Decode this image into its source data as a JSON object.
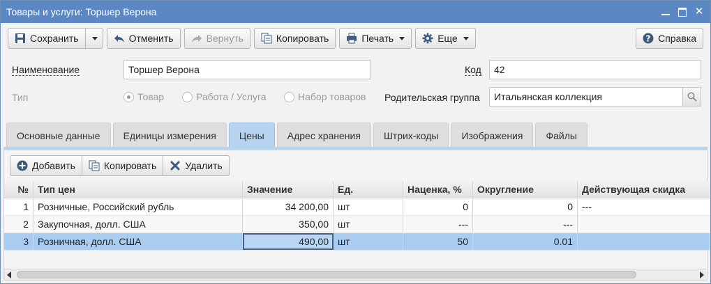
{
  "window": {
    "title": "Товары и услуги: Торшер Верона"
  },
  "toolbar": {
    "save": "Сохранить",
    "undo": "Отменить",
    "redo": "Вернуть",
    "copy": "Копировать",
    "print": "Печать",
    "more": "Еще",
    "help": "Справка"
  },
  "form": {
    "name_label": "Наименование",
    "name_value": "Торшер Верона",
    "code_label": "Код",
    "code_value": "42",
    "type_label": "Тип",
    "type_options": [
      "Товар",
      "Работа / Услуга",
      "Набор товаров"
    ],
    "type_selected": "Товар",
    "parent_label": "Родительская группа",
    "parent_value": "Итальянская коллекция"
  },
  "tabs": [
    "Основные данные",
    "Единицы измерения",
    "Цены",
    "Адрес хранения",
    "Штрих-коды",
    "Изображения",
    "Файлы"
  ],
  "active_tab": "Цены",
  "prices": {
    "add": "Добавить",
    "copy": "Копировать",
    "delete": "Удалить",
    "columns": [
      "№",
      "Тип цен",
      "Значение",
      "Ед.",
      "Наценка, %",
      "Округление",
      "Действующая скидка"
    ],
    "rows": [
      [
        "1",
        "Розничные, Российский рубль",
        "34 200,00",
        "шт",
        "0",
        "0",
        "---"
      ],
      [
        "2",
        "Закупочная, долл. США",
        "350,00",
        "шт",
        "---",
        "---",
        ""
      ],
      [
        "3",
        "Розничная, долл. США",
        "490,00",
        "шт",
        "50",
        "0.01",
        ""
      ]
    ],
    "selected_row": 3
  },
  "colors": {
    "titlebar": "#5b88c2",
    "active_tab": "#b6d3ef",
    "selected_row": "#a8cdf0"
  }
}
